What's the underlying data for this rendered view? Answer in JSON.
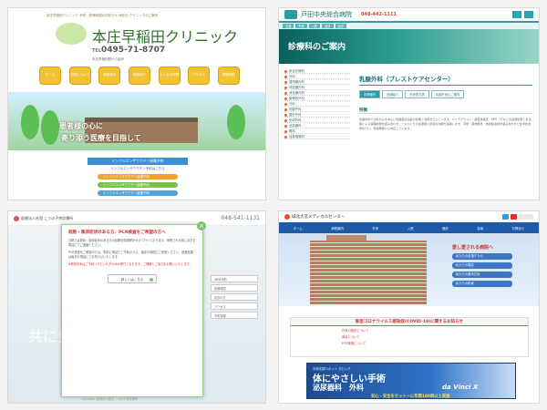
{
  "p1": {
    "notice": "本庄早稲田クリニック 予約・診療時間のお知らせ 休診日 クリニックのご案内",
    "name": "本庄早稲田クリニック",
    "tel_label": "TEL",
    "tel": "0495-71-8707",
    "address": "本庄早稲田駅から徒歩",
    "nav": [
      "ホーム",
      "当院について",
      "診療案内",
      "医師紹介",
      "よくある質問",
      "アクセス",
      "健康診断"
    ],
    "slogan1": "患者様の心に",
    "slogan2": "寄り添う医療を目指して",
    "flu_title": "インフルエンザワクチン接種予約",
    "flu_line": "インフルエンザワクチン予約はこちら",
    "pills": [
      "インフルエンザワクチン接種予約",
      "インフルエンザワクチン接種予約",
      "インフルエンザワクチン接種予約"
    ]
  },
  "p2": {
    "name": "戸田中央総合病院",
    "tel": "048-442-1111",
    "nav": [
      "交通",
      "外来",
      "入院",
      "健診",
      "採用"
    ],
    "banner": "診療科のご案内",
    "sidebar": [
      "総合診療科",
      "内科",
      "循環器内科",
      "呼吸器内科",
      "消化器内科",
      "脳神経外科",
      "外科",
      "乳腺外科",
      "整形外科",
      "形成外科",
      "泌尿器科",
      "眼科",
      "耳鼻咽喉科"
    ],
    "title": "乳腺外科（ブレストケアセンター）",
    "tabs": [
      "診療案内",
      "医師紹介",
      "外来担当表",
      "乳腺外来のご案内"
    ],
    "section": "特徴",
    "para": "乳腺外科では乳がんを中心に乳腺疾患全般の診断と治療を行っています。マンモグラフィ・超音波検査・MRI・CTなどの画像診断と針生検による病理診断を組み合わせ、一人ひとりの患者様に最適な治療を提案します。手術・薬物療法・放射線治療を組み合わせた集学的治療を行い、乳房再建にも対応しています。"
  },
  "p3": {
    "name": "医療法人社団 こうの子供診療所",
    "tel": "048-541-1131",
    "bg_text": "共に生き",
    "head": "発熱・風邪症状のある方、PCR検査をご希望の方へ",
    "p1": "当院では発熱・風邪症状のある方の診察を時間帯を分けて行っております。来院される前に必ずお電話にてご連絡ください。",
    "p2": "PCR検査をご希望の方は、事前に電話でご予約のうえ、指定の時間にご来院ください。検査結果は後日お電話にてお知らせいたします。",
    "red": "※発熱外来はご予約いただいた方のみの受付となります。ご理解とご協力をお願いいたします。",
    "button": "詳しくはこちら",
    "side": [
      "WEB予約",
      "診療時間",
      "初診の方",
      "アクセス",
      "予防接種"
    ],
    "footer": "Copyright 医療法人社団 こうの子供診療所"
  },
  "p4": {
    "name": "城北大宮メディカルセンター",
    "nav": [
      "ホーム",
      "病院案内",
      "外来",
      "入院",
      "健診",
      "採用",
      "お問合せ"
    ],
    "love": "愛し愛される病院へ",
    "tags": [
      "私たちの目指すもの",
      "私たちの理念",
      "私たちの基本方針",
      "私たちの約束"
    ],
    "covid_title": "新型コロナウイルス感染症(COVID-19)に関するお知らせ",
    "covid_lines": [
      "外来の受診について",
      "面会について",
      "PCR検査について"
    ],
    "robot_sub": "手術支援ロボット ダビンチ",
    "robot_t1": "体にやさしい手術",
    "robot_t2": "泌尿器科　外科",
    "robot_brand": "da Vinci X",
    "robot_foot": "安心・安全をモットーに年間100例以上実施"
  }
}
